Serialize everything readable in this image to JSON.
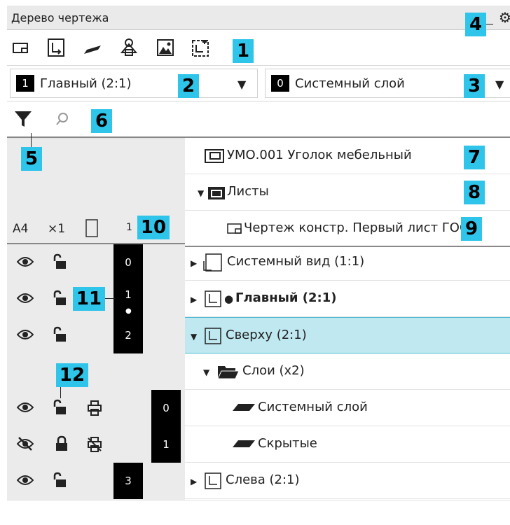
{
  "panel": {
    "title": "Дерево чертежа"
  },
  "combos": {
    "view": {
      "number": "1",
      "label": "Главный (2:1)"
    },
    "layer": {
      "number": "0",
      "label": "Системный слой"
    }
  },
  "sheet": {
    "format": "A4",
    "scale": "×1",
    "count": "1"
  },
  "tree": {
    "document": "УМО.001 Уголок мебельный",
    "sheets": "Листы",
    "sheet": "Чертеж констр. Первый лист ГОСТ",
    "views": [
      {
        "number": "0",
        "name": "Системный вид (1:1)"
      },
      {
        "number": "1",
        "name": "Главный (2:1)"
      },
      {
        "number": "2",
        "name": "Сверху (2:1)"
      },
      {
        "number": "3",
        "name": "Слева (2:1)"
      }
    ],
    "layers_group": "Слои (x2)",
    "layers": [
      {
        "number": "0",
        "name": "Системный слой"
      },
      {
        "number": "1",
        "name": "Скрытые"
      }
    ]
  },
  "callouts": [
    "1",
    "2",
    "3",
    "4",
    "5",
    "6",
    "7",
    "8",
    "9",
    "10",
    "11",
    "12"
  ],
  "colors": {
    "accent": "#2fc4ea",
    "selected_row": "#bfe8f0",
    "left_column_bg": "#ebebeb",
    "number_badge": "#000000"
  }
}
